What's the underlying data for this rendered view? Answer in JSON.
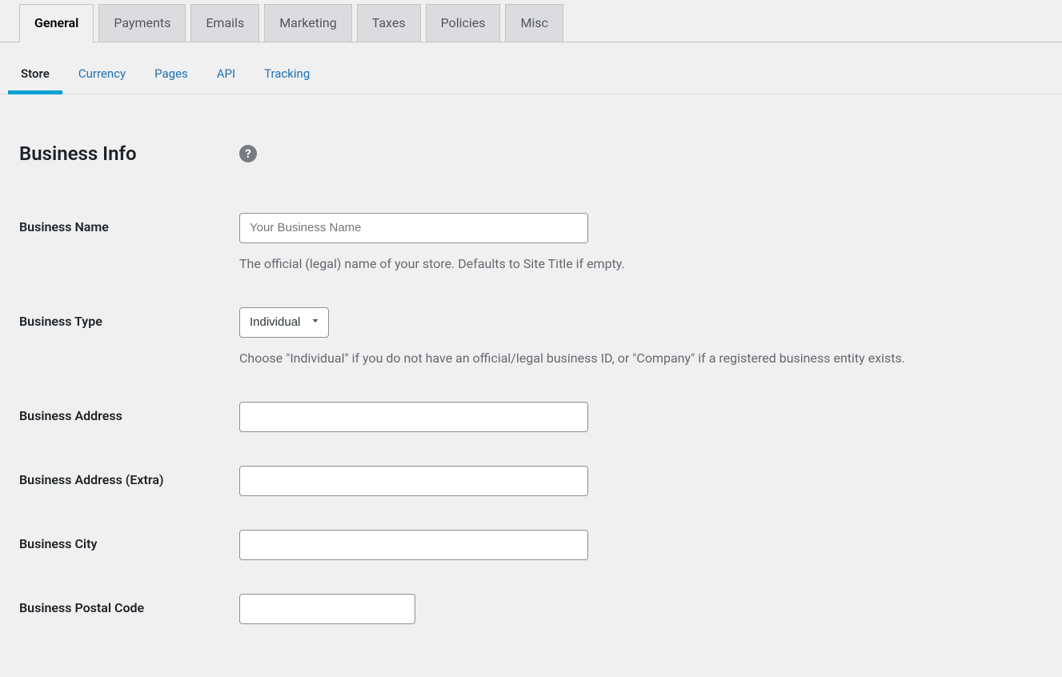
{
  "tabs": {
    "primary": [
      {
        "label": "General",
        "active": true
      },
      {
        "label": "Payments",
        "active": false
      },
      {
        "label": "Emails",
        "active": false
      },
      {
        "label": "Marketing",
        "active": false
      },
      {
        "label": "Taxes",
        "active": false
      },
      {
        "label": "Policies",
        "active": false
      },
      {
        "label": "Misc",
        "active": false
      }
    ],
    "secondary": [
      {
        "label": "Store",
        "active": true
      },
      {
        "label": "Currency",
        "active": false
      },
      {
        "label": "Pages",
        "active": false
      },
      {
        "label": "API",
        "active": false
      },
      {
        "label": "Tracking",
        "active": false
      }
    ]
  },
  "section": {
    "title": "Business Info",
    "help_symbol": "?"
  },
  "fields": {
    "business_name": {
      "label": "Business Name",
      "placeholder": "Your Business Name",
      "value": "",
      "description": "The official (legal) name of your store. Defaults to Site Title if empty."
    },
    "business_type": {
      "label": "Business Type",
      "selected": "Individual",
      "description": "Choose \"Individual\" if you do not have an official/legal business ID, or \"Company\" if a registered business entity exists."
    },
    "business_address": {
      "label": "Business Address",
      "value": ""
    },
    "business_address_extra": {
      "label": "Business Address (Extra)",
      "value": ""
    },
    "business_city": {
      "label": "Business City",
      "value": ""
    },
    "business_postal_code": {
      "label": "Business Postal Code",
      "value": ""
    }
  }
}
